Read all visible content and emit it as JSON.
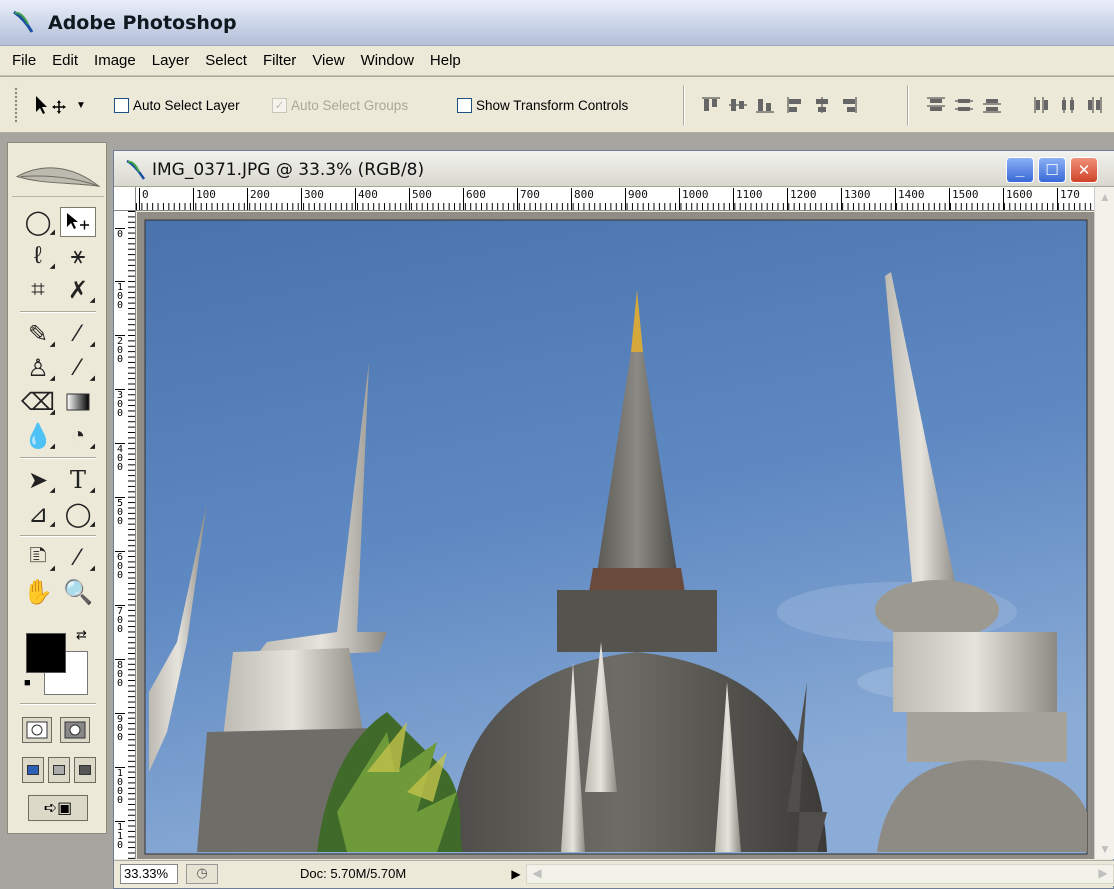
{
  "app": {
    "title": "Adobe Photoshop"
  },
  "menu": {
    "items": [
      "File",
      "Edit",
      "Image",
      "Layer",
      "Select",
      "Filter",
      "View",
      "Window",
      "Help"
    ]
  },
  "options": {
    "auto_select_layer": {
      "label": "Auto Select Layer",
      "checked": false,
      "enabled": true
    },
    "auto_select_groups": {
      "label": "Auto Select Groups",
      "checked": true,
      "enabled": false
    },
    "show_transform_controls": {
      "label": "Show Transform Controls",
      "checked": false,
      "enabled": true
    }
  },
  "document": {
    "title": "IMG_0371.JPG @ 33.3% (RGB/8)",
    "ruler_h": [
      "0",
      "100",
      "200",
      "300",
      "400",
      "500",
      "600",
      "700",
      "800",
      "900",
      "1000",
      "1100",
      "1200",
      "1300",
      "1400",
      "1500",
      "1600",
      "170"
    ],
    "ruler_v": [
      "0",
      "100",
      "200",
      "300",
      "400",
      "500",
      "600",
      "700",
      "800",
      "900",
      "1000",
      "110"
    ],
    "image_description": "photo of temple stupas against blue sky"
  },
  "status": {
    "zoom": "33.33%",
    "doc_info": "Doc: 5.70M/5.70M"
  },
  "colors": {
    "titlebar": "#c8d2e6",
    "chrome": "#ece9d8",
    "sky": "#5d86c0",
    "foreground_color": "#000000",
    "background_color": "#ffffff"
  }
}
